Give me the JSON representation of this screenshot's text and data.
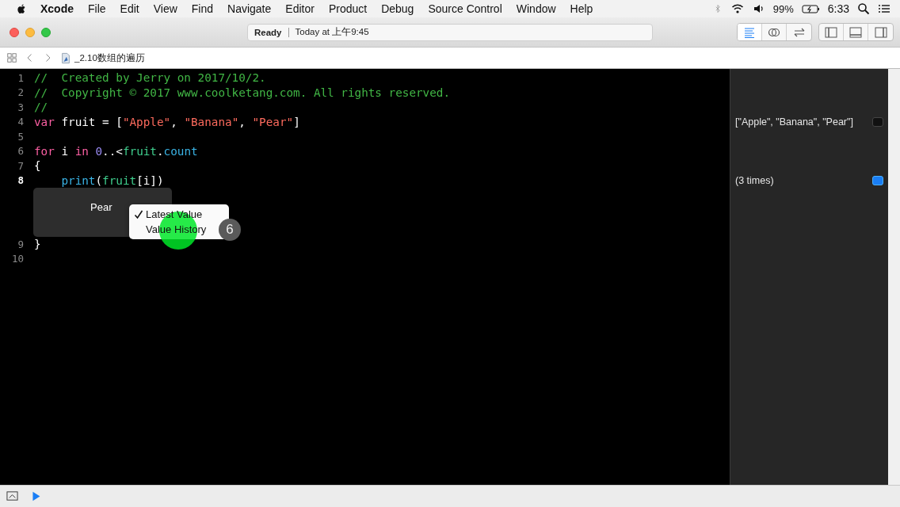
{
  "menu_bar": {
    "app": "Xcode",
    "menus": [
      "File",
      "Edit",
      "View",
      "Find",
      "Navigate",
      "Editor",
      "Product",
      "Debug",
      "Source Control",
      "Window",
      "Help"
    ],
    "battery": "99%",
    "time": "6:33"
  },
  "toolbar": {
    "status": "Ready",
    "message": "Today at 上午9:45",
    "editor_modes": [
      {
        "kind": "standard",
        "selected": true
      },
      {
        "kind": "assistant",
        "selected": false
      },
      {
        "kind": "version",
        "selected": false
      }
    ],
    "panels": [
      {
        "kind": "navigator"
      },
      {
        "kind": "debug"
      },
      {
        "kind": "utilities"
      }
    ]
  },
  "jump_bar": {
    "file": "_2.10数组的遍历"
  },
  "editor": {
    "lines": [
      {
        "number": "1",
        "current": false,
        "tokens": [
          {
            "kind": "comment",
            "text": "//  Created by Jerry on 2017/10/2."
          }
        ]
      },
      {
        "number": "2",
        "current": false,
        "tokens": [
          {
            "kind": "comment",
            "text": "//  Copyright © 2017 www.coolketang.com. All rights reserved."
          }
        ]
      },
      {
        "number": "3",
        "current": false,
        "tokens": [
          {
            "kind": "comment",
            "text": "//"
          }
        ]
      },
      {
        "number": "4",
        "current": false,
        "tokens": [
          {
            "kind": "keyword",
            "text": "var"
          },
          {
            "kind": "plain",
            "text": " fruit = ["
          },
          {
            "kind": "string",
            "text": "\"Apple\""
          },
          {
            "kind": "plain",
            "text": ", "
          },
          {
            "kind": "string",
            "text": "\"Banana\""
          },
          {
            "kind": "plain",
            "text": ", "
          },
          {
            "kind": "string",
            "text": "\"Pear\""
          },
          {
            "kind": "plain",
            "text": "]"
          }
        ],
        "result": {
          "text": "[\"Apple\", \"Banana\", \"Pear\"]",
          "shown": false
        }
      },
      {
        "number": "5",
        "current": false
      },
      {
        "number": "6",
        "current": false,
        "tokens": [
          {
            "kind": "keyword",
            "text": "for"
          },
          {
            "kind": "plain",
            "text": " i "
          },
          {
            "kind": "keyword",
            "text": "in"
          },
          {
            "kind": "number",
            "text": " 0"
          },
          {
            "kind": "plain",
            "text": "..<"
          },
          {
            "kind": "identifier",
            "text": "fruit"
          },
          {
            "kind": "plain",
            "text": "."
          },
          {
            "kind": "function",
            "text": "count"
          }
        ]
      },
      {
        "number": "7",
        "current": false,
        "tokens": [
          {
            "kind": "plain",
            "text": "{"
          }
        ]
      },
      {
        "number": "8",
        "current": true,
        "tokens": [
          {
            "kind": "function",
            "text": "    print"
          },
          {
            "kind": "plain",
            "text": "("
          },
          {
            "kind": "identifier",
            "text": "fruit"
          },
          {
            "kind": "plain",
            "text": "[i])"
          }
        ],
        "result": {
          "text": "(3 times)",
          "shown": true
        },
        "inline_result": {
          "value": "Pear",
          "menu": [
            {
              "label": "Latest Value",
              "selected": true
            },
            {
              "label": "Value History",
              "selected": false
            }
          ],
          "badge": "6"
        }
      },
      {
        "number": "9",
        "current": false,
        "tokens": [
          {
            "kind": "plain",
            "text": "}"
          }
        ]
      },
      {
        "number": "10",
        "current": false
      }
    ]
  }
}
